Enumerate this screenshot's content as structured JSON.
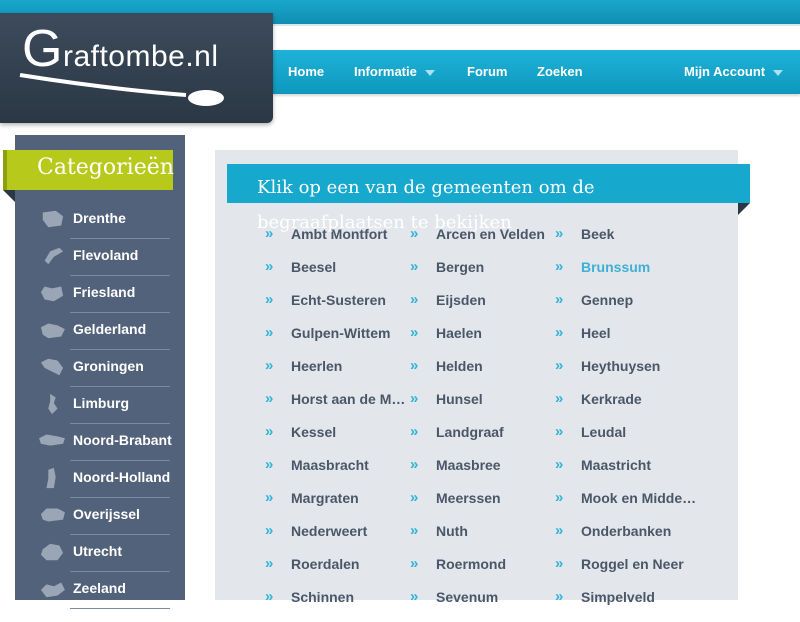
{
  "site": {
    "logo_big": "G",
    "logo_rest": "raftombe.nl"
  },
  "nav": {
    "home": "Home",
    "informatie": "Informatie",
    "forum": "Forum",
    "zoeken": "Zoeken",
    "account": "Mijn Account"
  },
  "sidebar": {
    "title": "Categorieën",
    "provinces": [
      "Drenthe",
      "Flevoland",
      "Friesland",
      "Gelderland",
      "Groningen",
      "Limburg",
      "Noord-Brabant",
      "Noord-Holland",
      "Overijssel",
      "Utrecht",
      "Zeeland"
    ]
  },
  "main": {
    "banner": "Klik op een van de gemeenten om de begraafplaatsen te bekijken",
    "chevron": "»",
    "active_municipality": "Brunssum",
    "municipalities": [
      [
        "Ambt Montfort",
        "Arcen en Velden",
        "Beek"
      ],
      [
        "Beesel",
        "Bergen",
        "Brunssum"
      ],
      [
        "Echt-Susteren",
        "Eijsden",
        "Gennep"
      ],
      [
        "Gulpen-Wittem",
        "Haelen",
        "Heel"
      ],
      [
        "Heerlen",
        "Helden",
        "Heythuysen"
      ],
      [
        "Horst aan de Maas",
        "Hunsel",
        "Kerkrade"
      ],
      [
        "Kessel",
        "Landgraaf",
        "Leudal"
      ],
      [
        "Maasbracht",
        "Maasbree",
        "Maastricht"
      ],
      [
        "Margraten",
        "Meerssen",
        "Mook en Middelaar"
      ],
      [
        "Nederweert",
        "Nuth",
        "Onderbanken"
      ],
      [
        "Roerdalen",
        "Roermond",
        "Roggel en Neer"
      ],
      [
        "Schinnen",
        "Sevenum",
        "Simpelveld"
      ]
    ]
  },
  "colors": {
    "nav_blue": "#0e98bd",
    "logo_dark": "#2b3744",
    "sidebar": "#52627a",
    "category_green": "#b7c91a",
    "active_link": "#3fb0d4"
  }
}
